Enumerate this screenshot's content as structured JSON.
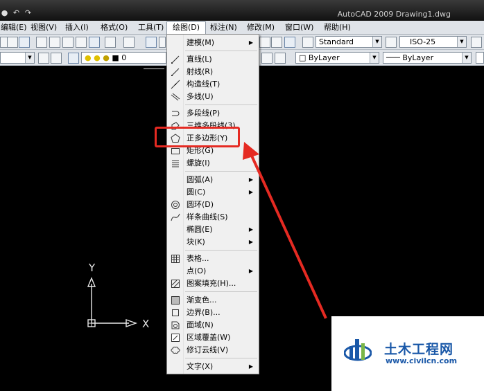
{
  "app": {
    "title": "AutoCAD 2009 Drawing1.dwg"
  },
  "menubar": [
    {
      "label": "编辑(E)"
    },
    {
      "label": "视图(V)"
    },
    {
      "label": "插入(I)"
    },
    {
      "label": "格式(O)"
    },
    {
      "label": "工具(T)"
    },
    {
      "label": "绘图(D)",
      "active": true
    },
    {
      "label": "标注(N)"
    },
    {
      "label": "修改(M)"
    },
    {
      "label": "窗口(W)"
    },
    {
      "label": "帮助(H)"
    }
  ],
  "toolbar": {
    "text_style": "Standard",
    "dim_style": "ISO-25",
    "layer": "0",
    "color": "ByLayer",
    "linetype": "ByLayer"
  },
  "draw_menu": {
    "items": [
      {
        "label": "建模(M)",
        "submenu": true
      },
      {
        "label": "直线(L)",
        "icon": "line-icon"
      },
      {
        "label": "射线(R)",
        "icon": "ray-icon"
      },
      {
        "label": "构造线(T)",
        "icon": "construction-line-icon"
      },
      {
        "label": "多线(U)",
        "icon": "multiline-icon"
      },
      {
        "label": "多段线(P)",
        "icon": "polyline-icon"
      },
      {
        "label": "三维多段线(3)",
        "icon": "3d-polyline-icon"
      },
      {
        "label": "正多边形(Y)",
        "icon": "polygon-icon",
        "highlighted": true
      },
      {
        "label": "矩形(G)",
        "icon": "rectangle-icon"
      },
      {
        "label": "螺旋(I)",
        "icon": "helix-icon"
      },
      {
        "label": "圆弧(A)",
        "submenu": true
      },
      {
        "label": "圆(C)",
        "submenu": true
      },
      {
        "label": "圆环(D)",
        "icon": "donut-icon"
      },
      {
        "label": "样条曲线(S)",
        "icon": "spline-icon"
      },
      {
        "label": "椭圆(E)",
        "submenu": true
      },
      {
        "label": "块(K)",
        "submenu": true
      },
      {
        "label": "表格...",
        "icon": "table-icon"
      },
      {
        "label": "点(O)",
        "submenu": true
      },
      {
        "label": "图案填充(H)...",
        "icon": "hatch-icon"
      },
      {
        "label": "渐变色...",
        "icon": "gradient-icon"
      },
      {
        "label": "边界(B)...",
        "icon": "boundary-icon"
      },
      {
        "label": "面域(N)",
        "icon": "region-icon"
      },
      {
        "label": "区域覆盖(W)",
        "icon": "wipeout-icon"
      },
      {
        "label": "修订云线(V)",
        "icon": "revcloud-icon"
      },
      {
        "label": "文字(X)",
        "submenu": true
      }
    ]
  },
  "ucs": {
    "x_label": "X",
    "y_label": "Y"
  },
  "watermark": {
    "name": "土木工程网",
    "url": "www.civilcn.com"
  },
  "colors": {
    "highlight": "#e52a22",
    "canvas": "#000000",
    "watermark": "#1a58a8"
  }
}
